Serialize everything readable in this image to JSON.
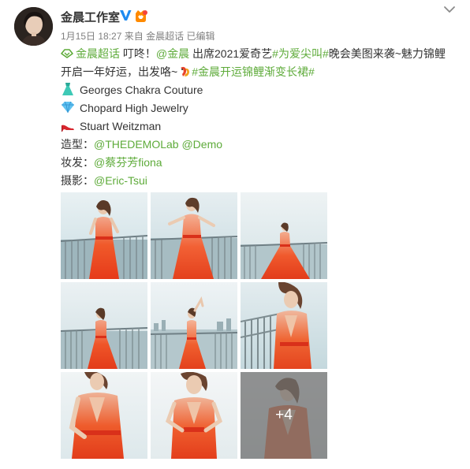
{
  "post": {
    "author": "金晨工作室",
    "verified_icon": "verified-v-icon",
    "fan_badge_icon": "fan-badge-icon",
    "time": "1月15日 18:27",
    "source_prefix": "来自",
    "source": "金晨超话",
    "edited": "已编辑",
    "menu_icon": "chevron-down-icon"
  },
  "content": {
    "line1": {
      "supertopic": "金晨超话",
      "text1": " 叮咚！",
      "mention": "@金晨",
      "text2": " 出席2021爱奇艺",
      "hashtag": "#为爱尖叫#",
      "text3": "晚会美图来袭~魅力锦鲤"
    },
    "line2": {
      "text1": "开启一年好运，出发咯~",
      "hashtag": "#金晨开运锦鲤渐变长裙#"
    },
    "dress": "Georges Chakra Couture",
    "jewelry": "Chopard High Jewelry",
    "shoes": "Stuart Weitzman",
    "styling_label": "造型：",
    "styling_mention1": "@THEDEMOLab",
    "styling_mention2": "@Demo",
    "makeup_label": "妆发：",
    "makeup_mention": "@蔡芬芳fiona",
    "photo_label": "摄影：",
    "photo_mention": "@Eric-Tsui"
  },
  "gallery": {
    "more_count": "+4"
  },
  "colors": {
    "link": "#5eab3a",
    "text": "#333333",
    "meta": "#808080",
    "dress_orange": "#f04a1e"
  }
}
